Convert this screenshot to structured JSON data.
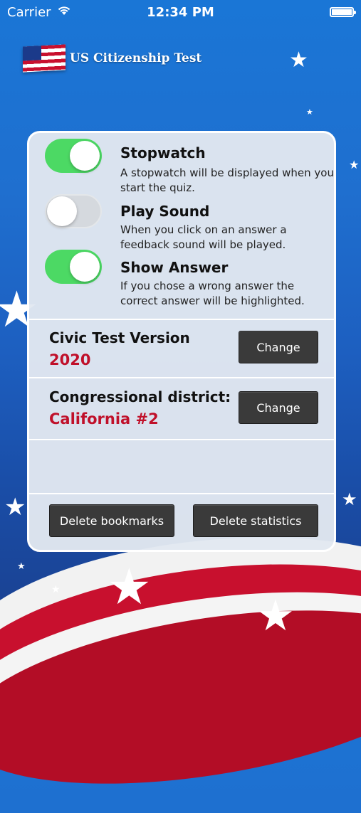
{
  "status_bar": {
    "carrier": "Carrier",
    "time": "12:34 PM"
  },
  "header": {
    "title": "US Citizenship Test"
  },
  "settings": {
    "options": [
      {
        "title": "Stopwatch",
        "description": "A stopwatch will be displayed when you start the quiz.",
        "enabled": true
      },
      {
        "title": "Play Sound",
        "description": "When you click on an answer a feedback sound will be played.",
        "enabled": false
      },
      {
        "title": "Show Answer",
        "description": "If you chose a wrong answer the correct answer will be highlighted.",
        "enabled": true
      }
    ],
    "civic_test": {
      "label": "Civic Test Version",
      "value": "2020",
      "button": "Change"
    },
    "district": {
      "label": "Congressional district:",
      "value": "California #2",
      "button": "Change"
    },
    "actions": {
      "delete_bookmarks": "Delete bookmarks",
      "delete_statistics": "Delete statistics"
    }
  },
  "colors": {
    "toggle_on": "#4cd964",
    "value_red": "#c0102a",
    "background_blue": "#1f6fcf",
    "button_dark": "#3a3a3a"
  }
}
